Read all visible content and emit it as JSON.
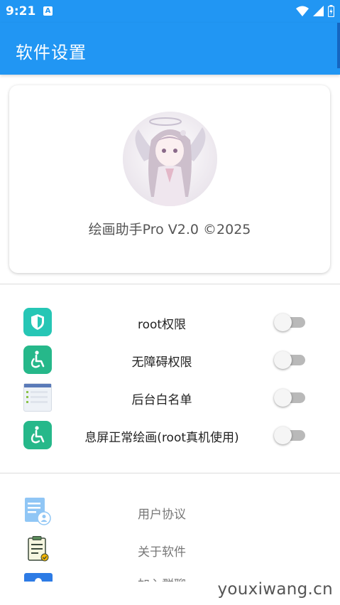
{
  "status_bar": {
    "time": "9:21",
    "notification_badge": "A"
  },
  "app_bar": {
    "title": "软件设置",
    "color": "#2196f3"
  },
  "profile": {
    "app_name": "绘画助手Pro V2.0 ©2025"
  },
  "permissions": [
    {
      "label": "root权限",
      "icon": "shield-icon",
      "icon_color": "#26c6b5",
      "enabled": false
    },
    {
      "label": "无障碍权限",
      "icon": "accessibility-icon",
      "icon_color": "#26b88a",
      "enabled": false
    },
    {
      "label": "后台白名单",
      "icon": "app-list-icon",
      "icon_color": "#eef2f7",
      "enabled": false
    },
    {
      "label": "息屏正常绘画(root真机使用)",
      "icon": "accessibility-icon",
      "icon_color": "#26b88a",
      "enabled": false
    }
  ],
  "links": [
    {
      "label": "用户协议",
      "icon": "user-agreement-icon"
    },
    {
      "label": "关于软件",
      "icon": "about-clipboard-icon"
    },
    {
      "label": "加入群聊",
      "icon": "join-group-icon"
    }
  ],
  "watermark": "youxiwang.cn"
}
